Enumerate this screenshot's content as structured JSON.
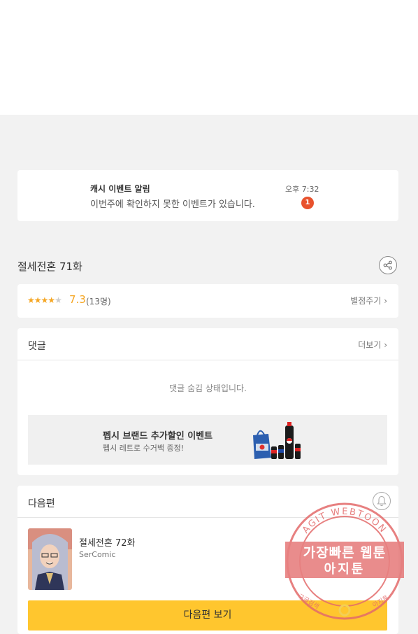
{
  "notification": {
    "title": "캐시 이벤트 알림",
    "message": "이번주에 확인하지 못한 이벤트가 있습니다.",
    "time": "오후 7:32",
    "badge_count": "1"
  },
  "episode": {
    "title": "절세전혼 71화",
    "share_icon": "share-icon"
  },
  "rating": {
    "stars_filled": 3.5,
    "stars_max": 5,
    "score": "7.3",
    "count": "(13명)",
    "rate_label": "별점주기 ›"
  },
  "comments": {
    "header": "댓글",
    "more_label": "더보기 ›",
    "hidden_message": "댓글 숨김 상태입니다."
  },
  "ad": {
    "title": "펩시 브랜드 추가할인 이벤트",
    "subtitle": "펩시 레트로 수거백 증정!"
  },
  "next_episode": {
    "header": "다음편",
    "title": "절세전혼 72화",
    "author": "SerComic",
    "button_label": "다음편 보기",
    "bell_icon": "bell-icon"
  },
  "watermark": {
    "arc_text": "AGIT WEBTOON",
    "line1": "가장빠른 웹툰",
    "line2": "아지툰",
    "bottom_left": "구글검색",
    "bottom_right": "아지툰",
    "center": "G"
  },
  "colors": {
    "accent_yellow": "#ffc62e",
    "star_orange": "#f5a623",
    "badge_red": "#e8522d",
    "background": "#f2f2f2"
  }
}
